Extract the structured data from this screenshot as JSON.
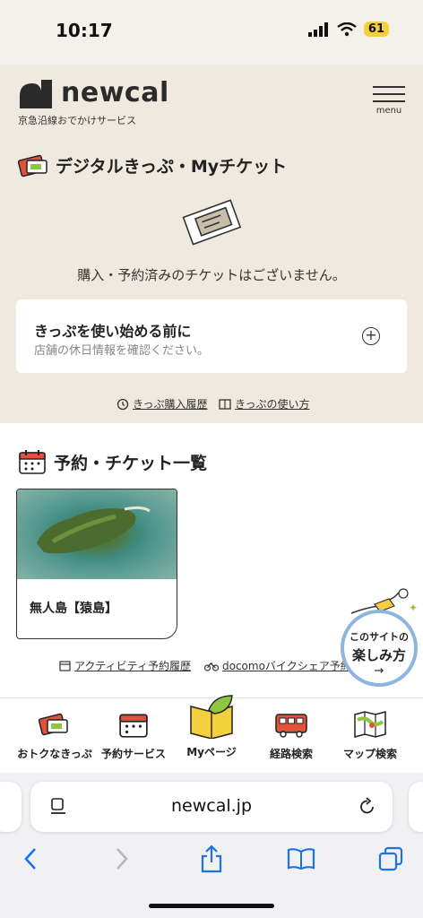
{
  "status": {
    "time": "10:17",
    "battery": "61"
  },
  "header": {
    "logo": "newcal",
    "subtitle": "京急沿線おでかけサービス",
    "menu_label": "menu"
  },
  "tickets": {
    "title": "デジタルきっぷ・Myチケット",
    "empty_message": "購入・予約済みのチケットはございません。",
    "notice_title": "きっぷを使い始める前に",
    "notice_sub": "店舗の休日情報を確認ください。",
    "link_history": "きっぷ購入履歴",
    "link_howto": "きっぷの使い方"
  },
  "reservations": {
    "title": "予約・チケット一覧",
    "card_label": "無人島【猿島】",
    "link_activity": "アクティビティ予約履歴",
    "link_bike": "docomoバイクシェア予約"
  },
  "badge": {
    "top": "このサイトの",
    "main": "楽しみ方",
    "arrow": "→"
  },
  "nav": {
    "items": [
      {
        "label": "おトクなきっぷ"
      },
      {
        "label": "予約サービス"
      },
      {
        "label": "Myページ"
      },
      {
        "label": "経路検索"
      },
      {
        "label": "マップ検索"
      }
    ]
  },
  "browser": {
    "url": "newcal.jp"
  },
  "colors": {
    "beige": "#efe9e0",
    "accent_red": "#e0533a",
    "accent_green": "#8ec63f",
    "link_blue": "#1a73e8"
  }
}
